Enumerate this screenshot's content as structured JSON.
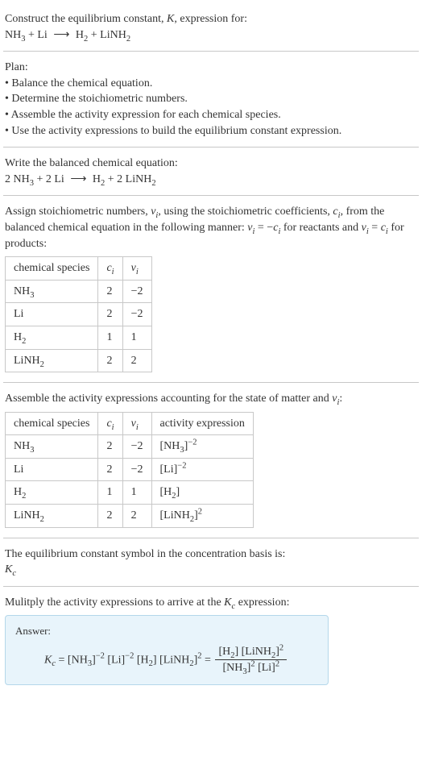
{
  "prompt": {
    "l1": "Construct the equilibrium constant, ",
    "Kvar": "K",
    "l1b": ", expression for:",
    "eq_lhs_a": "NH",
    "eq_lhs_a_sub": "3",
    "plus1": " + Li ",
    "arrow": "⟶",
    "eq_rhs_a": " H",
    "eq_rhs_a_sub": "2",
    "plus2": " + LiNH",
    "eq_rhs_b_sub": "2"
  },
  "plan": {
    "heading": "Plan:",
    "b1": "Balance the chemical equation.",
    "b2": "Determine the stoichiometric numbers.",
    "b3": "Assemble the activity expression for each chemical species.",
    "b4": "Use the activity expressions to build the equilibrium constant expression."
  },
  "balanced": {
    "heading": "Write the balanced chemical equation:",
    "c1": "2 NH",
    "c1_sub": "3",
    "c2": " + 2 Li ",
    "arrow": "⟶",
    "c3": " H",
    "c3_sub": "2",
    "c4": " + 2 LiNH",
    "c4_sub": "2"
  },
  "stoich": {
    "p_a": "Assign stoichiometric numbers, ",
    "nu": "ν",
    "sub_i": "i",
    "p_b": ", using the stoichiometric coefficients, ",
    "c": "c",
    "p_c": ", from the balanced chemical equation in the following manner: ",
    "rel1_a": "ν",
    "rel1_eq": " = −",
    "rel1_c": "c",
    "p_d": " for reactants and ",
    "rel2_a": "ν",
    "rel2_eq": " = ",
    "rel2_c": "c",
    "p_e": " for products:",
    "headers": {
      "species": "chemical species",
      "ci": "c",
      "ci_sub": "i",
      "nui": "ν",
      "nui_sub": "i"
    },
    "rows": [
      {
        "sp_a": "NH",
        "sp_sub": "3",
        "ci": "2",
        "nui": "−2"
      },
      {
        "sp_a": "Li",
        "sp_sub": "",
        "ci": "2",
        "nui": "−2"
      },
      {
        "sp_a": "H",
        "sp_sub": "2",
        "ci": "1",
        "nui": "1"
      },
      {
        "sp_a": "LiNH",
        "sp_sub": "2",
        "ci": "2",
        "nui": "2"
      }
    ]
  },
  "activity": {
    "heading_a": "Assemble the activity expressions accounting for the state of matter and ",
    "nu": "ν",
    "sub_i": "i",
    "heading_b": ":",
    "headers": {
      "species": "chemical species",
      "ci": "c",
      "ci_sub": "i",
      "nui": "ν",
      "nui_sub": "i",
      "act": "activity expression"
    },
    "rows": [
      {
        "sp_a": "NH",
        "sp_sub": "3",
        "ci": "2",
        "nui": "−2",
        "act_a": "[NH",
        "act_sub": "3",
        "act_b": "]",
        "act_sup": "−2"
      },
      {
        "sp_a": "Li",
        "sp_sub": "",
        "ci": "2",
        "nui": "−2",
        "act_a": "[Li",
        "act_sub": "",
        "act_b": "]",
        "act_sup": "−2"
      },
      {
        "sp_a": "H",
        "sp_sub": "2",
        "ci": "1",
        "nui": "1",
        "act_a": "[H",
        "act_sub": "2",
        "act_b": "]",
        "act_sup": ""
      },
      {
        "sp_a": "LiNH",
        "sp_sub": "2",
        "ci": "2",
        "nui": "2",
        "act_a": "[LiNH",
        "act_sub": "2",
        "act_b": "]",
        "act_sup": "2"
      }
    ]
  },
  "symbol": {
    "line1": "The equilibrium constant symbol in the concentration basis is:",
    "K": "K",
    "Ksub": "c"
  },
  "mult": {
    "heading_a": "Mulitply the activity expressions to arrive at the ",
    "K": "K",
    "Ksub": "c",
    "heading_b": " expression:"
  },
  "answer": {
    "label": "Answer:",
    "K": "K",
    "Ksub": "c",
    "eq": " = ",
    "t1": "[NH",
    "t1s": "3",
    "t1e": "]",
    "t1p": "−2",
    "t2": " [Li]",
    "t2p": "−2",
    "t3": " [H",
    "t3s": "2",
    "t3e": "]",
    "t4": " [LiNH",
    "t4s": "2",
    "t4e": "]",
    "t4p": "2",
    "eq2": " = ",
    "num_a": "[H",
    "num_as": "2",
    "num_ae": "] [LiNH",
    "num_bs": "2",
    "num_be": "]",
    "num_bp": "2",
    "den_a": "[NH",
    "den_as": "3",
    "den_ae": "]",
    "den_ap": "2",
    "den_b": " [Li]",
    "den_bp": "2"
  }
}
